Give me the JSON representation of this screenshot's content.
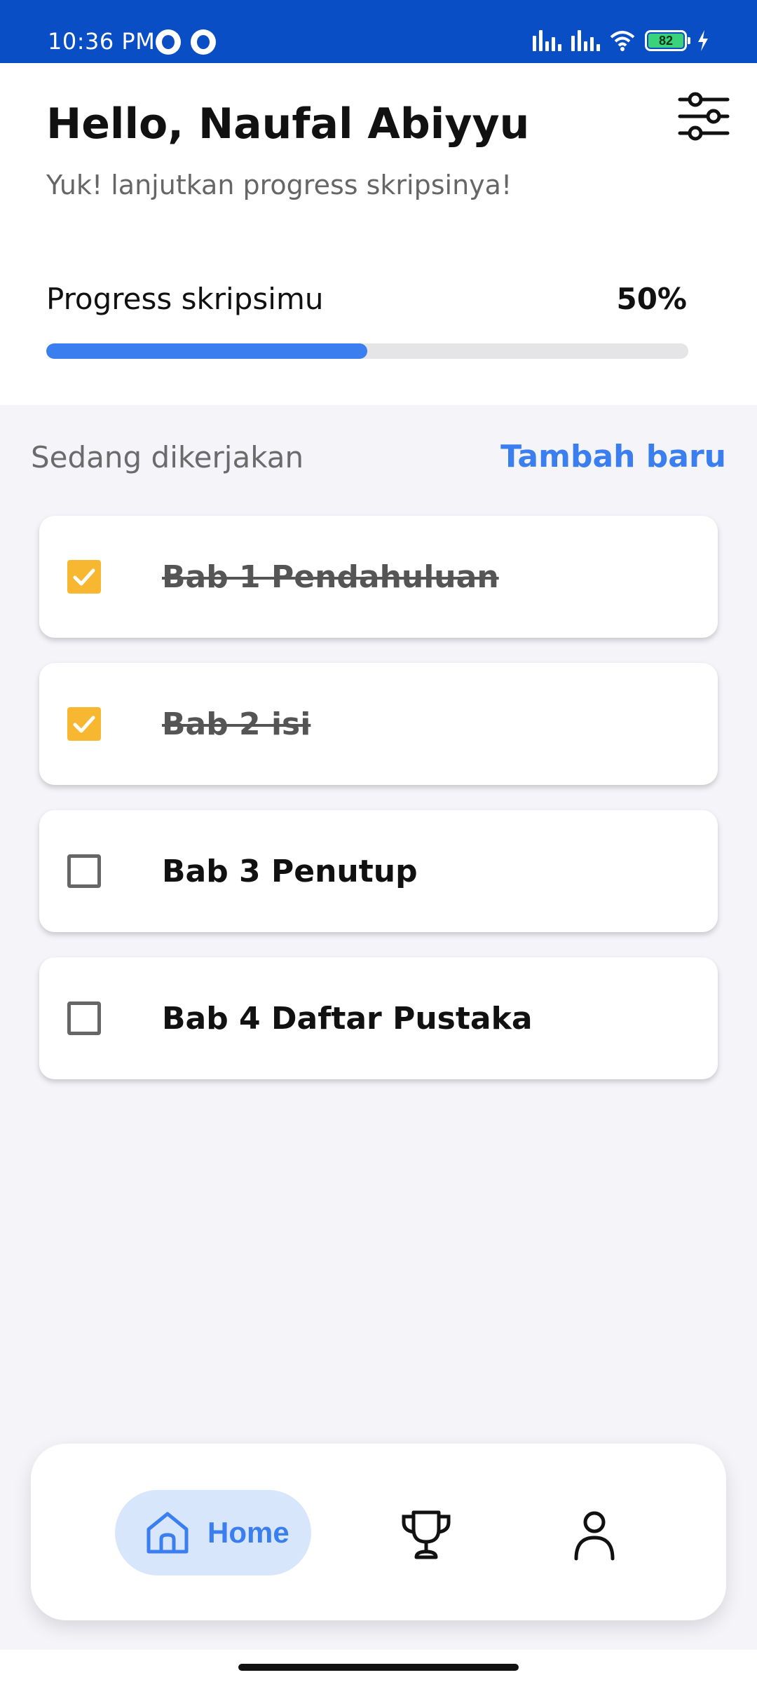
{
  "status_bar": {
    "time": "10:36 PM",
    "battery": "82",
    "app_icons": [
      "circle-app-icon",
      "circle-app-icon"
    ]
  },
  "header": {
    "greeting": "Hello, Naufal Abiyyu",
    "subtitle": "Yuk! lanjutkan progress skripsinya!",
    "filter_icon": "sliders-icon"
  },
  "progress": {
    "label": "Progress skripsimu",
    "value_text": "50%",
    "value": 0.5,
    "color": "#3a7ef0"
  },
  "section": {
    "title": "Sedang dikerjakan",
    "add_label": "Tambah baru"
  },
  "tasks": [
    {
      "title": "Bab 1 Pendahuluan",
      "done": true
    },
    {
      "title": "Bab 2 isi",
      "done": true
    },
    {
      "title": "Bab 3 Penutup",
      "done": false
    },
    {
      "title": "Bab 4 Daftar Pustaka",
      "done": false
    }
  ],
  "nav": {
    "home_label": "Home",
    "items": [
      "home-icon",
      "trophy-icon",
      "profile-icon"
    ],
    "active": "home"
  },
  "colors": {
    "status_bar": "#0a4ec6",
    "accent": "#3a7ef0",
    "checkbox_checked": "#f7b731",
    "nav_active_bg": "#d8e6fc"
  }
}
